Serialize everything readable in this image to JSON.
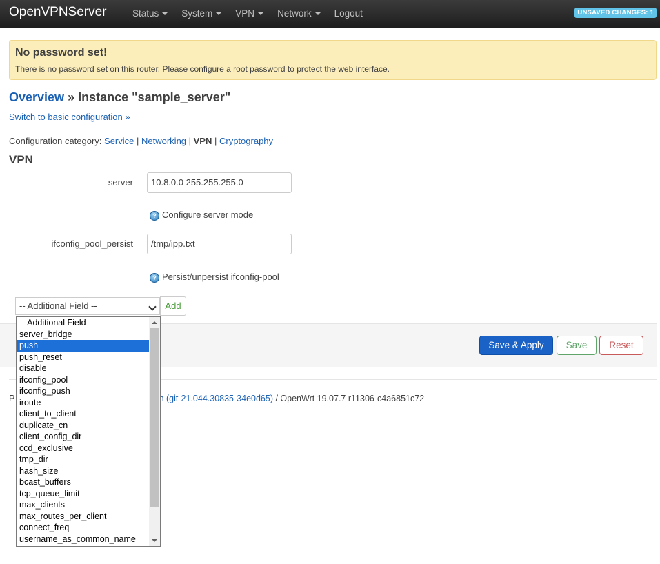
{
  "navbar": {
    "brand": "OpenVPNServer",
    "menu": [
      "Status",
      "System",
      "VPN",
      "Network"
    ],
    "logout": "Logout",
    "unsaved": "UNSAVED CHANGES: 1"
  },
  "alert": {
    "title": "No password set!",
    "text": "There is no password set on this router. Please configure a root password to protect the web interface."
  },
  "page": {
    "overview_link": "Overview",
    "crumb_rest": " » Instance \"sample_server\"",
    "basic_link": "Switch to basic configuration »",
    "category_label": "Configuration category: ",
    "cat_service": "Service",
    "cat_networking": "Networking",
    "cat_vpn": "VPN",
    "cat_crypto": "Cryptography",
    "sep": " | ",
    "section_title": "VPN"
  },
  "fields": {
    "server": {
      "label": "server",
      "value": "10.8.0.0 255.255.255.0",
      "hint": "Configure server mode"
    },
    "pool": {
      "label": "ifconfig_pool_persist",
      "value": "/tmp/ipp.txt",
      "hint": "Persist/unpersist ifconfig-pool"
    }
  },
  "additional": {
    "selected": "-- Additional Field --",
    "add_label": "Add",
    "options": [
      "-- Additional Field --",
      "server_bridge",
      "push",
      "push_reset",
      "disable",
      "ifconfig_pool",
      "ifconfig_push",
      "iroute",
      "client_to_client",
      "duplicate_cn",
      "client_config_dir",
      "ccd_exclusive",
      "tmp_dir",
      "hash_size",
      "bcast_buffers",
      "tcp_queue_limit",
      "max_clients",
      "max_routes_per_client",
      "connect_freq",
      "username_as_common_name"
    ],
    "highlighted": "push"
  },
  "actions": {
    "apply": "Save & Apply",
    "save": "Save",
    "reset": "Reset"
  },
  "footer": {
    "lead": "P",
    "link": "ch (git-21.044.30835-34e0d65)",
    "rest": " / OpenWrt 19.07.7 r11306-c4a6851c72"
  }
}
